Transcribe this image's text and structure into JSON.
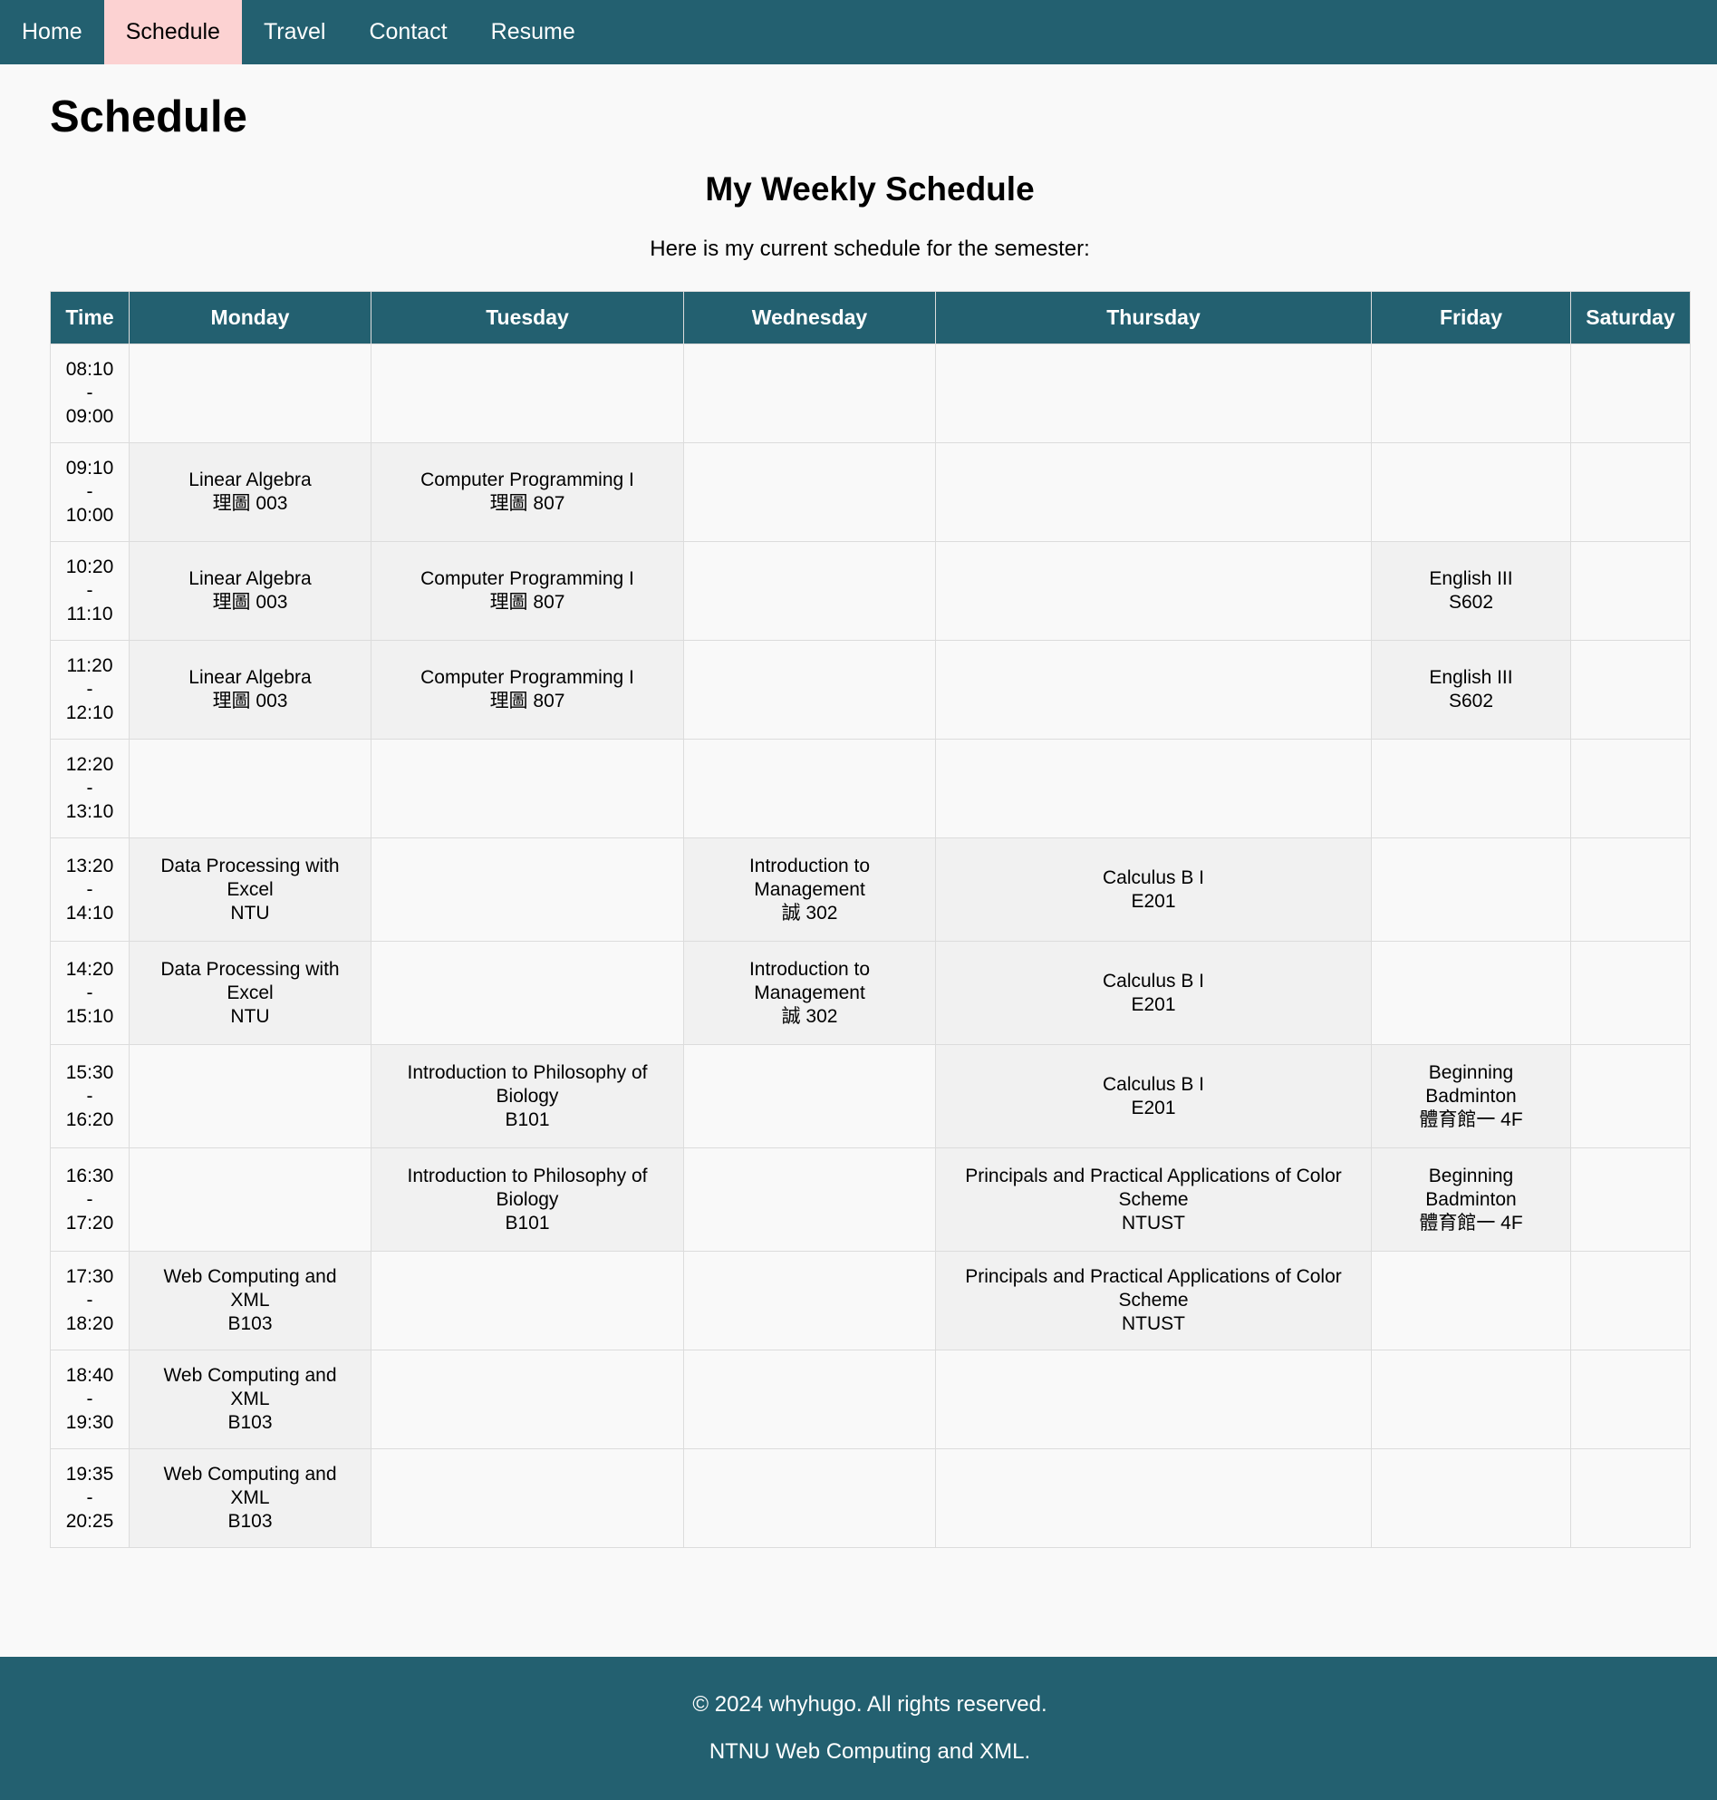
{
  "nav": {
    "items": [
      {
        "label": "Home",
        "active": false
      },
      {
        "label": "Schedule",
        "active": true
      },
      {
        "label": "Travel",
        "active": false
      },
      {
        "label": "Contact",
        "active": false
      },
      {
        "label": "Resume",
        "active": false
      }
    ]
  },
  "page": {
    "title": "Schedule",
    "subtitle": "My Weekly Schedule",
    "intro": "Here is my current schedule for the semester:"
  },
  "schedule": {
    "headers": [
      "Time",
      "Monday",
      "Tuesday",
      "Wednesday",
      "Thursday",
      "Friday",
      "Saturday"
    ],
    "rows": [
      {
        "start": "08:10",
        "end": "09:00",
        "cells": [
          null,
          null,
          null,
          null,
          null,
          null
        ]
      },
      {
        "start": "09:10",
        "end": "10:00",
        "cells": [
          [
            "Linear Algebra",
            "理圖 003"
          ],
          [
            "Computer Programming I",
            "理圖 807"
          ],
          null,
          null,
          null,
          null
        ]
      },
      {
        "start": "10:20",
        "end": "11:10",
        "cells": [
          [
            "Linear Algebra",
            "理圖 003"
          ],
          [
            "Computer Programming I",
            "理圖 807"
          ],
          null,
          null,
          [
            "English III",
            "S602"
          ],
          null
        ]
      },
      {
        "start": "11:20",
        "end": "12:10",
        "cells": [
          [
            "Linear Algebra",
            "理圖 003"
          ],
          [
            "Computer Programming I",
            "理圖 807"
          ],
          null,
          null,
          [
            "English III",
            "S602"
          ],
          null
        ]
      },
      {
        "start": "12:20",
        "end": "13:10",
        "cells": [
          null,
          null,
          null,
          null,
          null,
          null
        ]
      },
      {
        "start": "13:20",
        "end": "14:10",
        "cells": [
          [
            "Data Processing with Excel",
            "NTU"
          ],
          null,
          [
            "Introduction to Management",
            "誠 302"
          ],
          [
            "Calculus B I",
            "E201"
          ],
          null,
          null
        ]
      },
      {
        "start": "14:20",
        "end": "15:10",
        "cells": [
          [
            "Data Processing with Excel",
            "NTU"
          ],
          null,
          [
            "Introduction to Management",
            "誠 302"
          ],
          [
            "Calculus B I",
            "E201"
          ],
          null,
          null
        ]
      },
      {
        "start": "15:30",
        "end": "16:20",
        "cells": [
          null,
          [
            "Introduction to Philosophy of Biology",
            "B101"
          ],
          null,
          [
            "Calculus B I",
            "E201"
          ],
          [
            "Beginning Badminton",
            "體育館一 4F"
          ],
          null
        ]
      },
      {
        "start": "16:30",
        "end": "17:20",
        "cells": [
          null,
          [
            "Introduction to Philosophy of Biology",
            "B101"
          ],
          null,
          [
            "Principals and Practical Applications of Color Scheme",
            "NTUST"
          ],
          [
            "Beginning Badminton",
            "體育館一 4F"
          ],
          null
        ]
      },
      {
        "start": "17:30",
        "end": "18:20",
        "cells": [
          [
            "Web Computing and XML",
            "B103"
          ],
          null,
          null,
          [
            "Principals and Practical Applications of Color Scheme",
            "NTUST"
          ],
          null,
          null
        ]
      },
      {
        "start": "18:40",
        "end": "19:30",
        "cells": [
          [
            "Web Computing and XML",
            "B103"
          ],
          null,
          null,
          null,
          null,
          null
        ]
      },
      {
        "start": "19:35",
        "end": "20:25",
        "cells": [
          [
            "Web Computing and XML",
            "B103"
          ],
          null,
          null,
          null,
          null,
          null
        ]
      }
    ]
  },
  "footer": {
    "copyright": "© 2024 whyhugo. All rights reserved.",
    "course": "NTNU Web Computing and XML."
  },
  "colors": {
    "primary": "#236070",
    "active_tab": "#fcd2d2",
    "background": "#f9f9f9",
    "filled_cell": "#f1f1f1"
  }
}
